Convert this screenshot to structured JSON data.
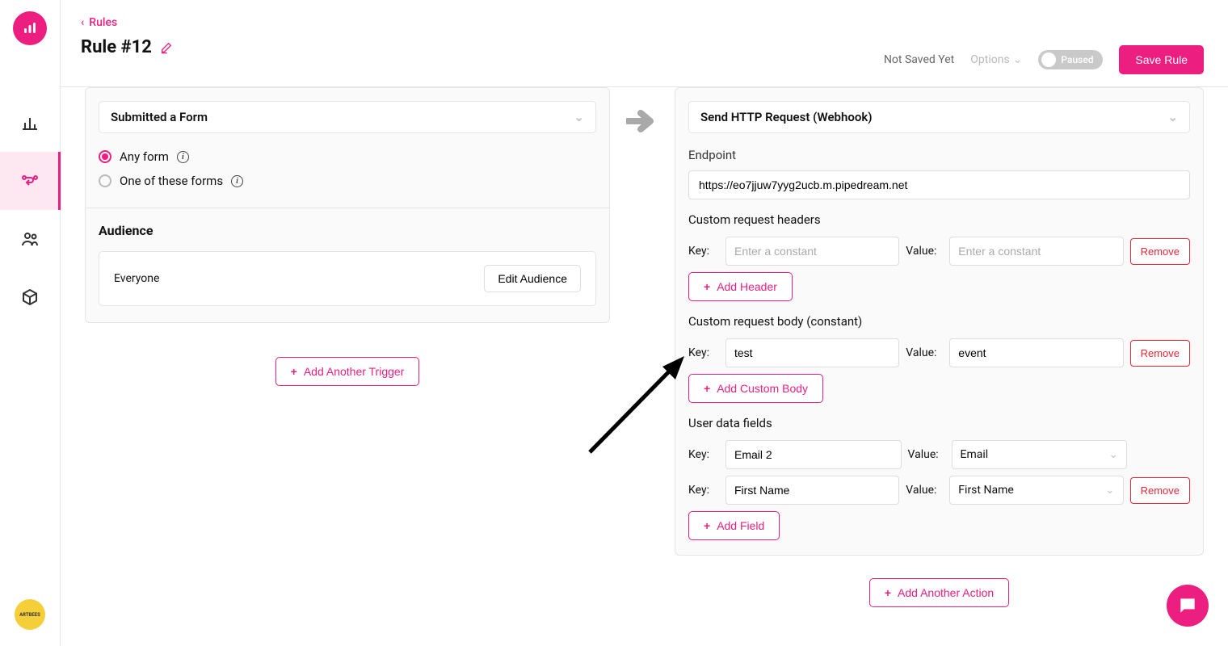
{
  "breadcrumb": {
    "label": "Rules"
  },
  "header": {
    "title": "Rule #12",
    "not_saved": "Not Saved Yet",
    "options": "Options",
    "toggle_label": "Paused",
    "save_btn": "Save Rule"
  },
  "trigger": {
    "select_label": "Submitted a Form",
    "radio_any": "Any form",
    "radio_one": "One of these forms",
    "audience_title": "Audience",
    "audience_value": "Everyone",
    "edit_audience": "Edit Audience",
    "add_another": "Add Another Trigger"
  },
  "action": {
    "select_label": "Send HTTP Request (Webhook)",
    "endpoint_label": "Endpoint",
    "endpoint_value": "https://eo7jjuw7yyg2ucb.m.pipedream.net",
    "headers_title": "Custom request headers",
    "key_label": "Key:",
    "value_label": "Value:",
    "placeholder": "Enter a constant",
    "remove": "Remove",
    "add_header": "Add Header",
    "body_title": "Custom request body (constant)",
    "body_key": "test",
    "body_value": "event",
    "add_body": "Add Custom Body",
    "user_fields_title": "User data fields",
    "fields": [
      {
        "key": "Email 2",
        "value": "Email"
      },
      {
        "key": "First Name",
        "value": "First Name"
      }
    ],
    "add_field": "Add Field",
    "add_another": "Add Another Action"
  },
  "bottom_badge": "ARTBEES"
}
